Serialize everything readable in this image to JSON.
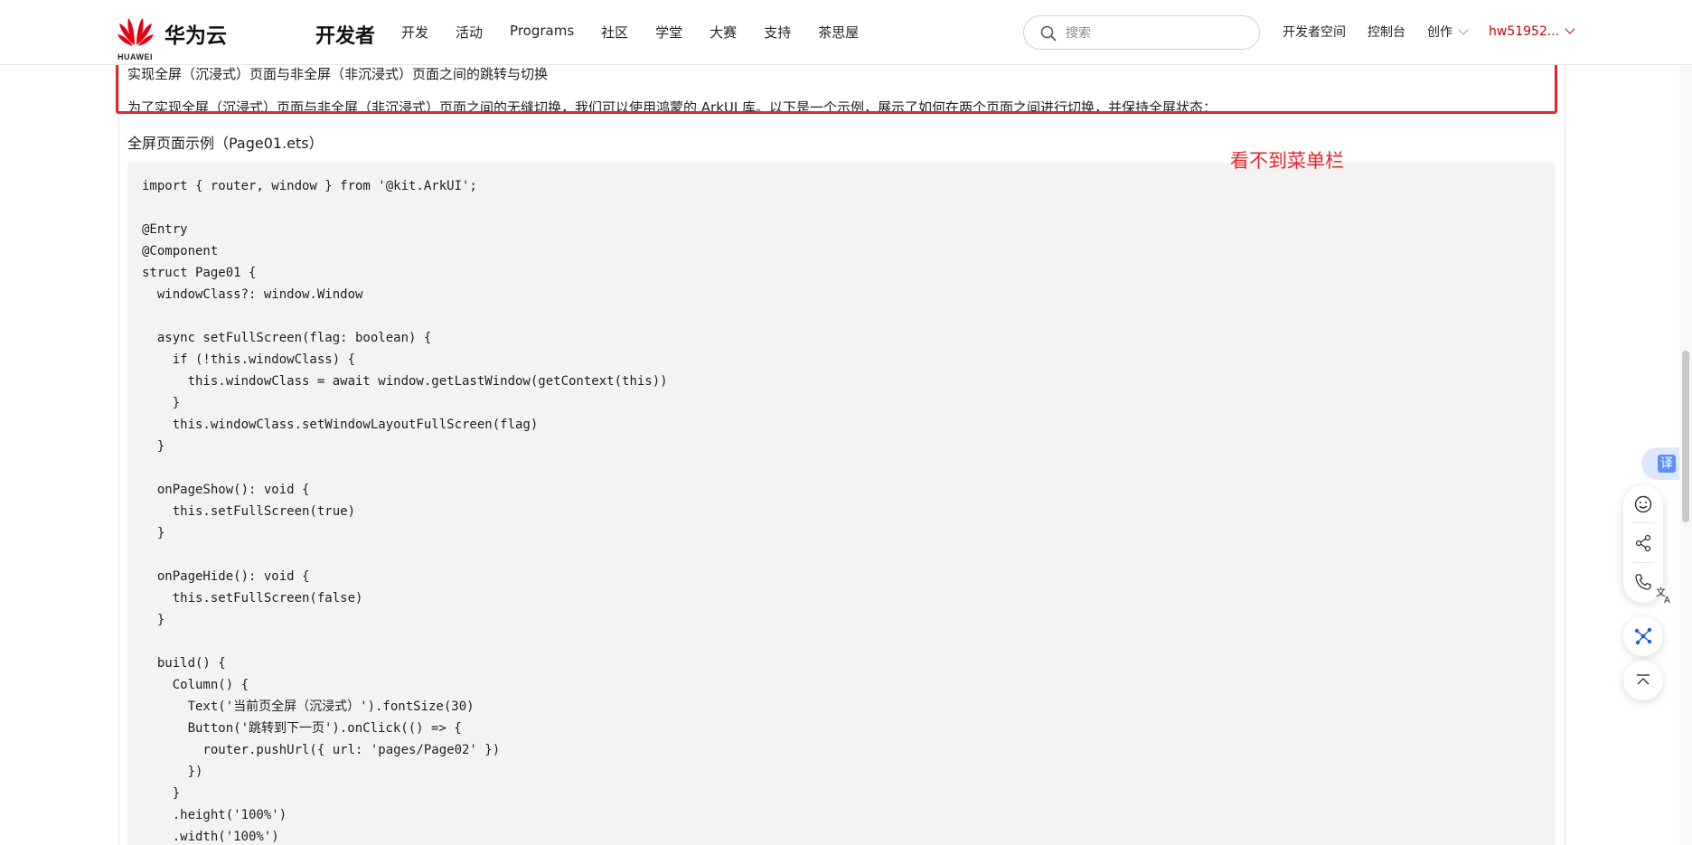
{
  "nav": {
    "logo_brand": "华为云",
    "logo_wordmark": "HUAWEI",
    "site_title": "开发者",
    "links": [
      "开发",
      "活动",
      "Programs",
      "社区",
      "学堂",
      "大赛",
      "支持",
      "茶思屋"
    ],
    "search_placeholder": "搜索",
    "right_links": [
      "开发者空间",
      "控制台",
      "创作"
    ],
    "user": "hw51952..."
  },
  "article": {
    "heading": "实现全屏（沉浸式）页面与非全屏（非沉浸式）页面之间的跳转与切换",
    "intro": "为了实现全屏（沉浸式）页面与非全屏（非沉浸式）页面之间的无缝切换，我们可以使用鸿蒙的 ArkUI 库。以下是一个示例，展示了如何在两个页面之间进行切换，并保持全屏状态：",
    "example_label": "全屏页面示例（Page01.ets）",
    "annotation": "看不到菜单栏",
    "code_lines": [
      "import { router, window } from '@kit.ArkUI';",
      "",
      "@Entry",
      "@Component",
      "struct Page01 {",
      "  windowClass?: window.Window",
      "",
      "  async setFullScreen(flag: boolean) {",
      "    if (!this.windowClass) {",
      "      this.windowClass = await window.getLastWindow(getContext(this))",
      "    }",
      "    this.windowClass.setWindowLayoutFullScreen(flag)",
      "  }",
      "",
      "  onPageShow(): void {",
      "    this.setFullScreen(true)",
      "  }",
      "",
      "  onPageHide(): void {",
      "    this.setFullScreen(false)",
      "  }",
      "",
      "  build() {",
      "    Column() {",
      "      Text('当前页全屏（沉浸式）').fontSize(30)",
      "      Button('跳转到下一页').onClick(() => {",
      "        router.pushUrl({ url: 'pages/Page02' })",
      "      })",
      "    }",
      "    .height('100%')",
      "    .width('100%')"
    ]
  },
  "tools": {
    "translate_label": "译",
    "icons": [
      "smile-icon",
      "share-icon",
      "phone-icon",
      "ai-assistant-icon",
      "back-to-top-icon"
    ]
  },
  "colors": {
    "brand_red": "#c7000b",
    "highlight_red": "#e8232b",
    "code_bg": "#f5f3f1"
  }
}
